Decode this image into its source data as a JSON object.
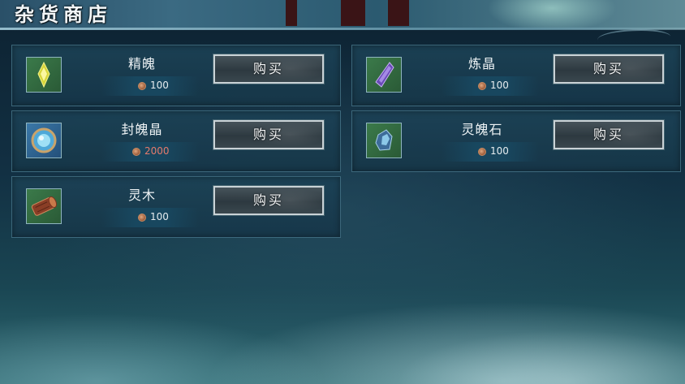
{
  "title": "杂货商店",
  "items": [
    {
      "name": "精魄",
      "price": "100",
      "icon": "spirit-essence-icon"
    },
    {
      "name": "炼晶",
      "price": "100",
      "icon": "refining-crystal-icon"
    },
    {
      "name": "封魄晶",
      "price": "2000",
      "icon": "soul-seal-crystal-icon"
    },
    {
      "name": "灵魄石",
      "price": "100",
      "icon": "soul-stone-icon"
    },
    {
      "name": "灵木",
      "price": "100",
      "icon": "spirit-wood-icon"
    }
  ],
  "buy_label": "购买",
  "colors": {
    "price_insufficient": "#e47a6c",
    "price_normal": "#e6ecef"
  }
}
